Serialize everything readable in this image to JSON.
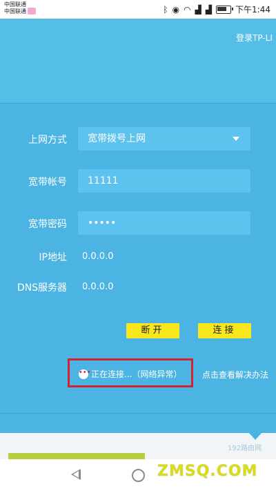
{
  "statusbar": {
    "carrier1": "中国联通",
    "carrier2": "中国联通",
    "time": "下午1:44"
  },
  "header": {
    "login_link": "登录TP-LI"
  },
  "form": {
    "connection_type_label": "上网方式",
    "connection_type_value": "宽带拨号上网",
    "account_label": "宽带帐号",
    "account_value": "11111",
    "password_label": "宽带密码",
    "password_value": "•••••",
    "ip_label": "IP地址",
    "ip_value": "0.0.0.0",
    "dns_label": "DNS服务器",
    "dns_value": "0.0.0.0"
  },
  "buttons": {
    "disconnect": "断开",
    "connect": "连接"
  },
  "status": {
    "text": "正在连接...（网络异常）",
    "help_link": "点击查看解决办法"
  },
  "watermark": {
    "text": "ZMSQ.COM",
    "small": "192路由网"
  },
  "colors": {
    "background": "#4cb4e3",
    "field": "#5dc3ee",
    "button": "#f8e71c",
    "highlight_box": "#d3242d"
  }
}
